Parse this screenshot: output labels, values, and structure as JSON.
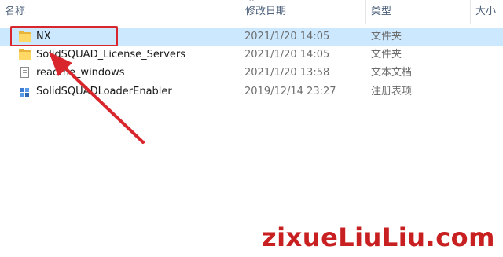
{
  "columns": {
    "name": "名称",
    "date": "修改日期",
    "type": "类型",
    "size": "大小"
  },
  "sort_indicator": "^",
  "files": [
    {
      "name": "NX",
      "date": "2021/1/20 14:05",
      "type": "文件夹",
      "icon": "folder-icon",
      "selected": true
    },
    {
      "name": "SolidSQUAD_License_Servers",
      "date": "2021/1/20 14:05",
      "type": "文件夹",
      "icon": "folder-icon",
      "selected": false
    },
    {
      "name": "readme_windows",
      "date": "2021/1/20 13:58",
      "type": "文本文档",
      "icon": "text-document-icon",
      "selected": false
    },
    {
      "name": "SolidSQUADLoaderEnabler",
      "date": "2019/12/14 23:27",
      "type": "注册表项",
      "icon": "registry-file-icon",
      "selected": false
    }
  ],
  "annotation": {
    "color": "#d9262c"
  },
  "colors": {
    "selection": "#cce8ff",
    "folder": "#ffd866",
    "watermark": "#c81f21"
  },
  "watermark": "zixueLiuLiu.com"
}
